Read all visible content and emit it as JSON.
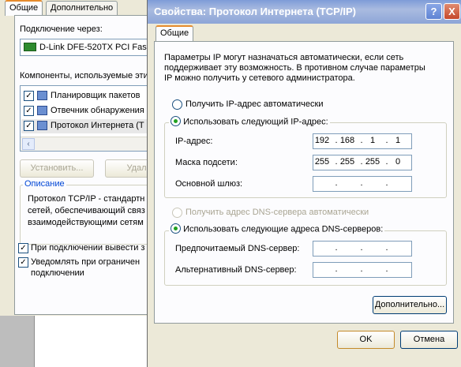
{
  "background_window": {
    "tabs": [
      "Общие",
      "Дополнительно"
    ],
    "connect_using_label": "Подключение через:",
    "adapter_name": "D-Link DFE-520TX PCI Fast",
    "components_label": "Компоненты, используемые эти",
    "components": [
      {
        "label": "Планировщик пакетов",
        "checked": true
      },
      {
        "label": "Отвечник обнаружения",
        "checked": true
      },
      {
        "label": "Протокол Интернета (T",
        "checked": true
      }
    ],
    "install_button": "Установить...",
    "remove_button": "Удал",
    "description_title": "Описание",
    "description_text": [
      "Протокол TCP/IP - стандартн",
      "сетей, обеспечивающий связ",
      "взаимодействующими сетям"
    ],
    "show_icon_label": "При подключении вывести з",
    "notify_label": "Уведомлять при ограничен",
    "notify_label_2": "подключении"
  },
  "dialog": {
    "title": "Свойства: Протокол Интернета (TCP/IP)",
    "help_button": "?",
    "close_button": "X",
    "tab_general": "Общие",
    "intro": [
      "Параметры IP могут назначаться автоматически, если сеть",
      "поддерживает эту возможность. В противном случае параметры",
      "IP можно получить у сетевого администратора."
    ],
    "radio_auto_ip": "Получить IP-адрес автоматически",
    "radio_manual_ip": "Использовать следующий IP-адрес:",
    "ip_label": "IP-адрес:",
    "ip_octets": [
      "192",
      "168",
      "1",
      "1"
    ],
    "mask_label": "Маска подсети:",
    "mask_octets": [
      "255",
      "255",
      "255",
      "0"
    ],
    "gateway_label": "Основной шлюз:",
    "radio_auto_dns": "Получить адрес DNS-сервера автоматически",
    "radio_manual_dns": "Использовать следующие адреса DNS-серверов:",
    "preferred_dns_label": "Предпочитаемый DNS-сервер:",
    "alternate_dns_label": "Альтернативный DNS-сервер:",
    "advanced_button": "Дополнительно...",
    "ok_button": "OK",
    "cancel_button": "Отмена",
    "dot": "."
  }
}
